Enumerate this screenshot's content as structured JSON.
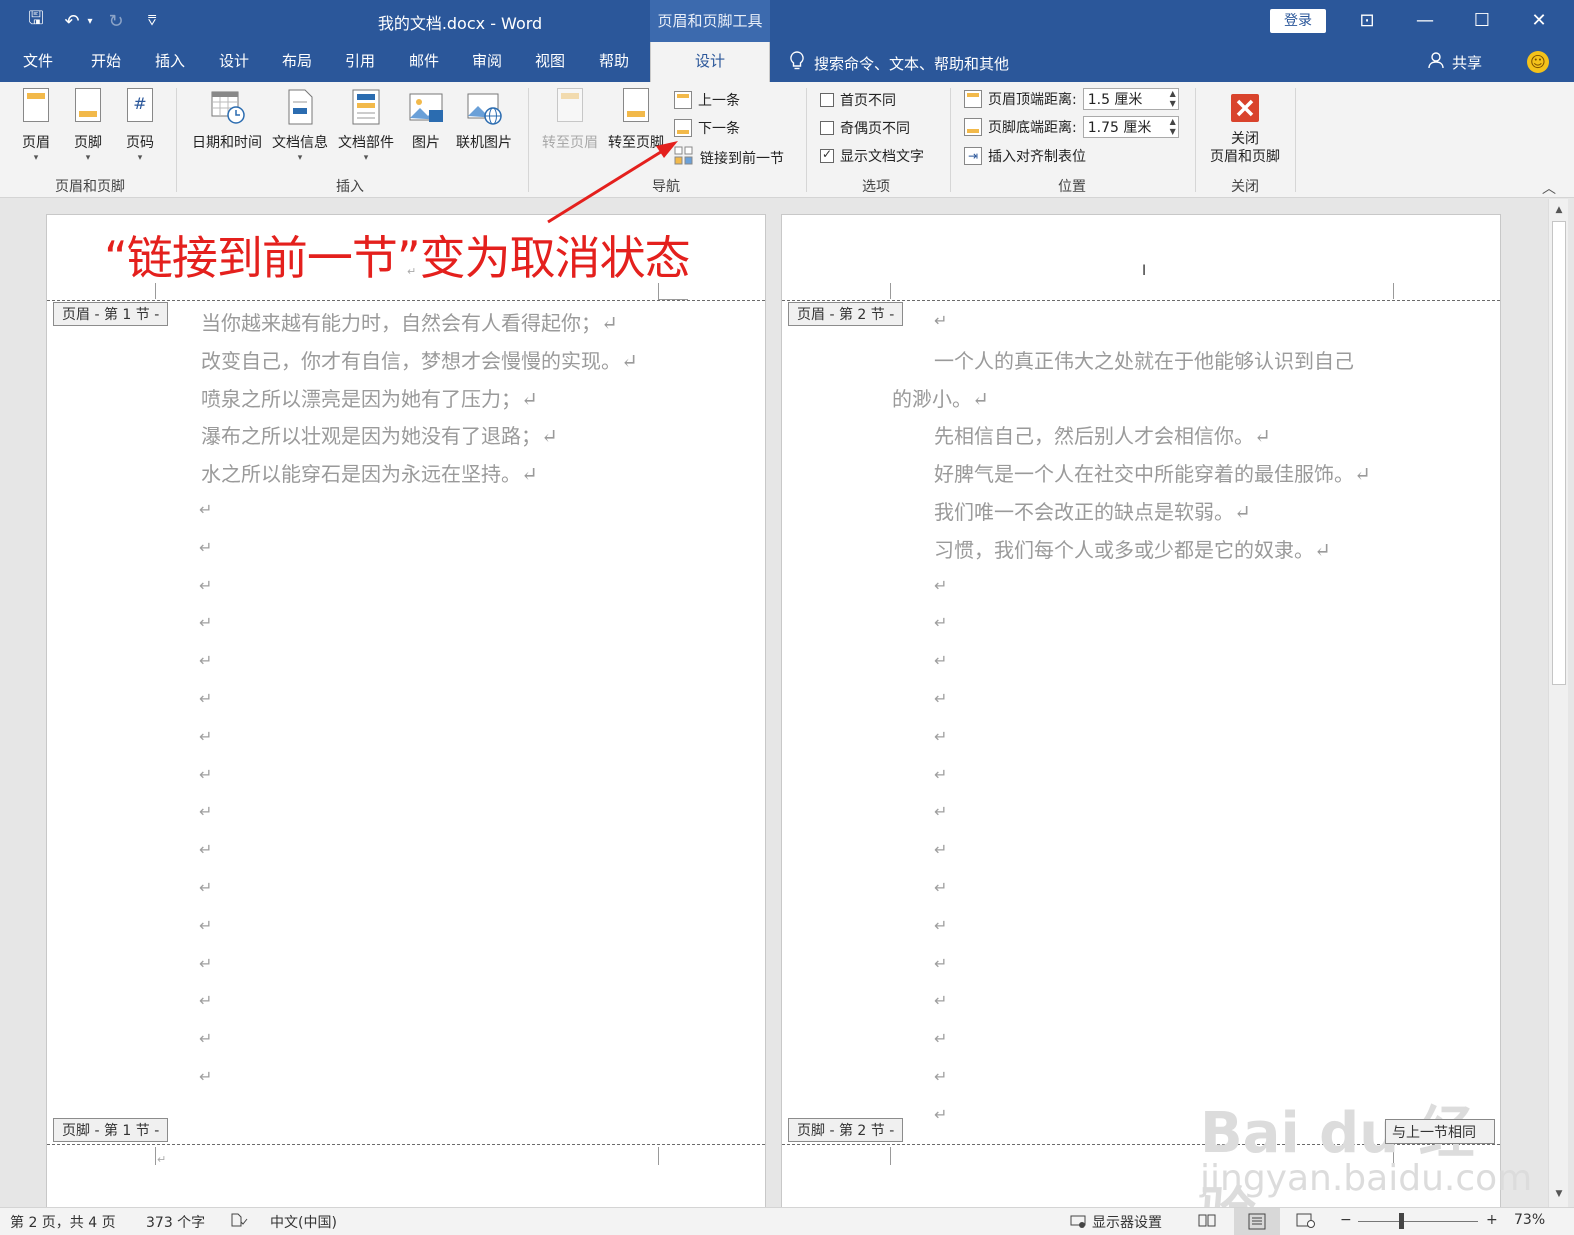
{
  "titlebar": {
    "doc_title": "我的文档.docx  -  Word",
    "context_tools": "页眉和页脚工具",
    "login": "登录",
    "save_glyph": "🖫",
    "undo_glyph": "↶",
    "redo_glyph": "↻",
    "customize_glyph": "⩢",
    "ribbon_display_glyph": "⊡",
    "minimize_glyph": "—",
    "maximize_glyph": "☐",
    "close_glyph": "✕"
  },
  "menu": {
    "tabs": [
      "文件",
      "开始",
      "插入",
      "设计",
      "布局",
      "引用",
      "邮件",
      "审阅",
      "视图",
      "帮助"
    ],
    "active_tab": "设计",
    "search_placeholder": "搜索命令、文本、帮助和其他",
    "share": "共享",
    "smiley": "☺"
  },
  "ribbon": {
    "groups": {
      "header_footer": {
        "label": "页眉和页脚",
        "buttons": [
          "页眉",
          "页脚",
          "页码"
        ],
        "caret": "▾"
      },
      "insert": {
        "label": "插入",
        "buttons": [
          "日期和时间",
          "文档信息",
          "文档部件",
          "图片",
          "联机图片"
        ]
      },
      "navigation": {
        "label": "导航",
        "goto_header": "转至页眉",
        "goto_footer": "转至页脚",
        "previous": "上一条",
        "next": "下一条",
        "link_previous": "链接到前一节"
      },
      "options": {
        "label": "选项",
        "items": [
          {
            "label": "首页不同",
            "checked": false
          },
          {
            "label": "奇偶页不同",
            "checked": false
          },
          {
            "label": "显示文档文字",
            "checked": true
          }
        ]
      },
      "position": {
        "label": "位置",
        "header_top_label": "页眉顶端距离:",
        "header_top_value": "1.5 厘米",
        "footer_bottom_label": "页脚底端距离:",
        "footer_bottom_value": "1.75 厘米",
        "insert_align_tab": "插入对齐制表位"
      },
      "close": {
        "label": "关闭",
        "button_line1": "关闭",
        "button_line2": "页眉和页脚"
      }
    },
    "collapse_glyph": "︿"
  },
  "annotation": "“链接到前一节”变为取消状态",
  "pages": {
    "left": {
      "header_tag": "页眉 - 第 1 节 -",
      "footer_tag": "页脚 - 第 1 节 -",
      "lines": [
        "当你越来越有能力时，自然会有人看得起你；↵",
        "改变自己，你才有自信，梦想才会慢慢的实现。↵",
        "喷泉之所以漂亮是因为她有了压力；↵",
        "瀑布之所以壮观是因为她没有了退路；↵",
        "水之所以能穿石是因为永远在坚持。↵"
      ],
      "empty_mark": "↵",
      "empty_count": 16
    },
    "right": {
      "header_tag": "页眉 - 第 2 节 -",
      "footer_tag": "页脚 - 第 2 节 -",
      "lines": [
        "↵",
        "一个人的真正伟大之处就在于他能够认识到自己",
        "的渺小。↵",
        "先相信自己，然后别人才会相信你。↵",
        "好脾气是一个人在社交中所能穿着的最佳服饰。↵",
        "我们唯一不会改正的缺点是软弱。↵",
        "习惯，我们每个人或多或少都是它的奴隶。↵"
      ],
      "empty_mark": "↵",
      "empty_count": 15,
      "same_as_previous_partial": "与上一节相同"
    }
  },
  "status": {
    "page": "第 2 页，共 4 页",
    "words": "373 个字",
    "proof_icon": "proofing-icon",
    "language": "中文(中国)",
    "display_settings": "显示器设置",
    "zoom_minus": "−",
    "zoom_plus": "+",
    "zoom": "73%"
  },
  "watermark": {
    "line1": "Bai du 经验",
    "line2": "jingyan.baidu.com"
  },
  "colors": {
    "word_blue": "#2b579a",
    "annotation_red": "#e4201d"
  }
}
